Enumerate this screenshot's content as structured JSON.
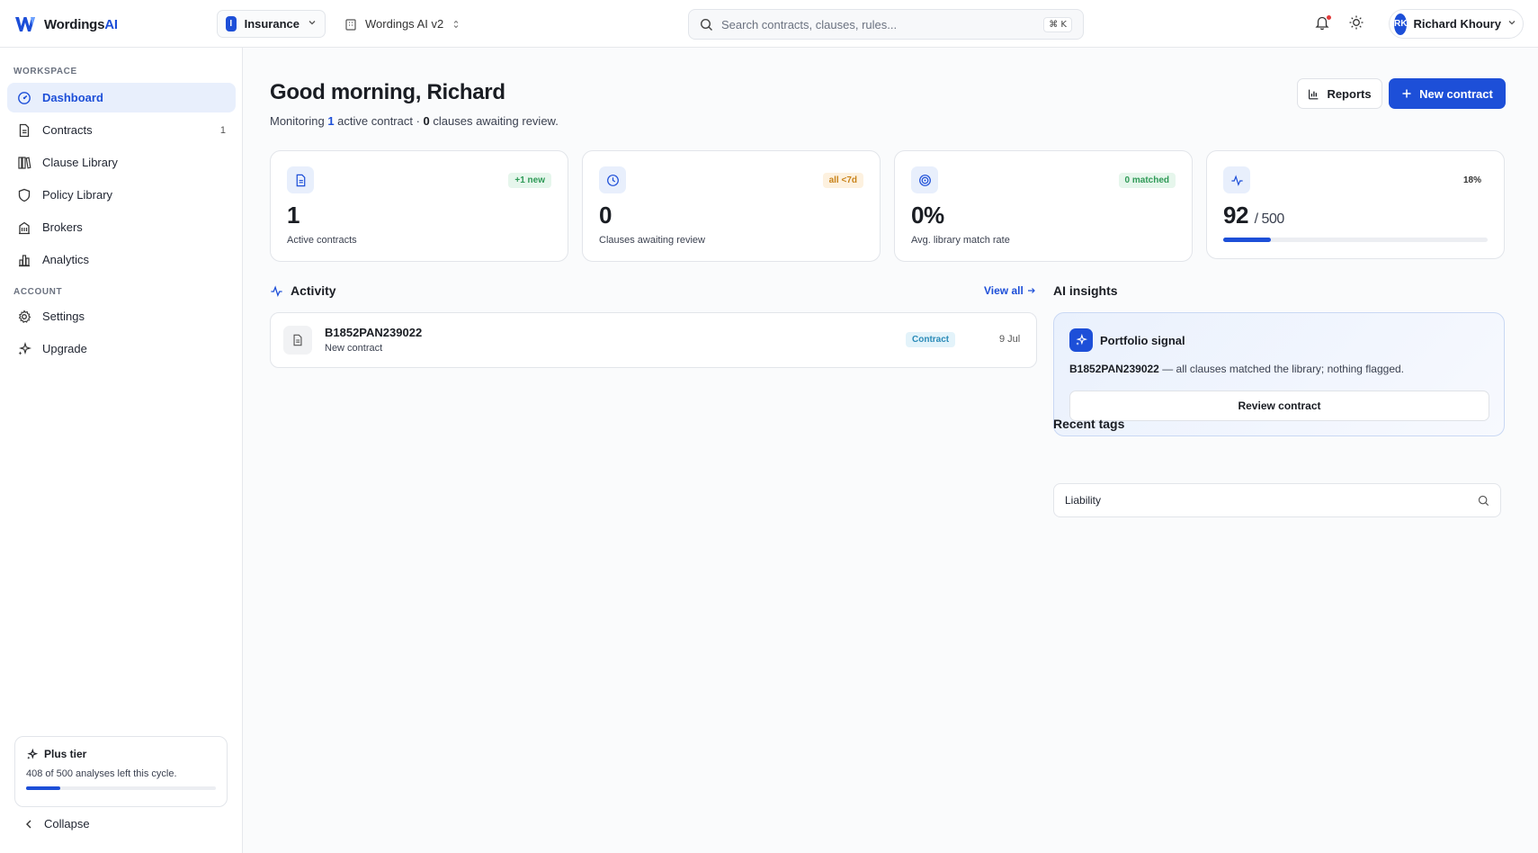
{
  "brand": {
    "name_main": "Wordings",
    "name_accent": "AI"
  },
  "topbar": {
    "workspace_badge": "I",
    "workspace": "Insurance",
    "project": "Wordings AI v2",
    "search_placeholder": "Search contracts, clauses, rules...",
    "search_shortcut": "⌘ K",
    "user_initials": "RK",
    "user_name": "Richard Khoury"
  },
  "sidebar": {
    "workspace_heading": "WORKSPACE",
    "account_heading": "ACCOUNT",
    "items": [
      {
        "label": "Dashboard",
        "icon": "dashboard-icon",
        "active": true,
        "count": ""
      },
      {
        "label": "Contracts",
        "icon": "document-icon",
        "active": false,
        "count": "1"
      },
      {
        "label": "Clause Library",
        "icon": "library-icon",
        "active": false,
        "count": ""
      },
      {
        "label": "Policy Library",
        "icon": "shield-icon",
        "active": false,
        "count": ""
      },
      {
        "label": "Brokers",
        "icon": "building-icon",
        "active": false,
        "count": ""
      },
      {
        "label": "Analytics",
        "icon": "bar-chart-icon",
        "active": false,
        "count": ""
      }
    ],
    "account_items": [
      {
        "label": "Settings",
        "icon": "gear-icon"
      },
      {
        "label": "Upgrade",
        "icon": "sparkle-icon"
      }
    ],
    "plan": {
      "title": "Plus tier",
      "text": "408 of 500 analyses left this cycle.",
      "progress": 0.18
    },
    "collapse_label": "Collapse"
  },
  "main": {
    "greeting": "Good morning, Richard",
    "sub_prefix": "Monitoring ",
    "sub_count": "1",
    "sub_middle": " active contract · ",
    "sub_clauses": "0",
    "sub_suffix": " clauses awaiting review.",
    "reports_label": "Reports",
    "new_contract_label": "New contract",
    "stats": [
      {
        "value": "1",
        "label": "Active contracts",
        "badge": "+1 new",
        "badge_style": "green",
        "icon": "document-icon"
      },
      {
        "value": "0",
        "label": "Clauses awaiting review",
        "badge": "all <7d",
        "badge_style": "amber",
        "icon": "clock-icon"
      },
      {
        "value": "0%",
        "label": "Avg. library match rate",
        "badge": "0 matched",
        "badge_style": "green",
        "icon": "target-icon"
      },
      {
        "value": "92",
        "of": "/ 500",
        "label": "",
        "badge": "18%",
        "badge_style": "plain",
        "icon": "pulse-icon",
        "progress": 0.18
      }
    ],
    "activity": {
      "title": "Activity",
      "view_all": "View all",
      "items": [
        {
          "title": "B1852PAN239022",
          "subtitle": "New contract",
          "tag": "Contract",
          "date": "9 Jul"
        }
      ]
    },
    "insights": {
      "title": "AI insights",
      "card_title": "Portfolio signal",
      "ref": "B1852PAN239022",
      "text": " — all clauses matched the library; nothing flagged.",
      "button": "Review contract"
    },
    "tags": {
      "title": "Recent tags",
      "value": "Liability"
    }
  },
  "colors": {
    "accent": "#1d4fd8",
    "badge_green": "#2f9a57",
    "badge_amber": "#c9831a",
    "notification": "#e23b3b"
  }
}
